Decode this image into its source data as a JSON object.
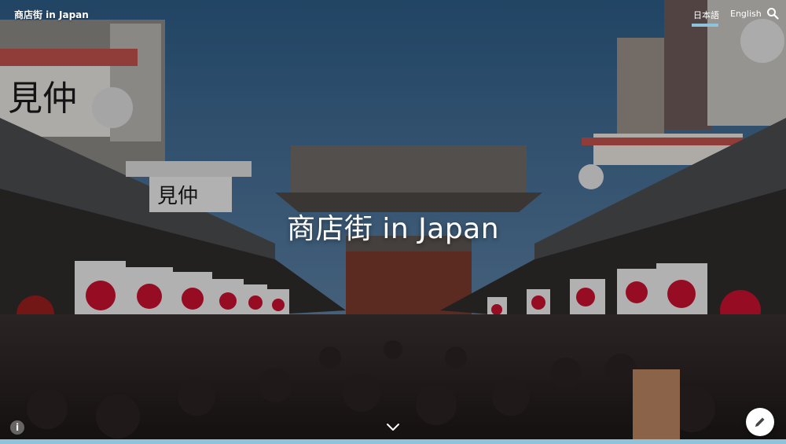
{
  "site": {
    "title": "商店街 in Japan"
  },
  "nav": {
    "languages": [
      {
        "label": "日本語",
        "active": true
      },
      {
        "label": "English",
        "active": false
      }
    ],
    "search_icon": "search-icon"
  },
  "hero": {
    "title": "商店街 in Japan",
    "background": "photo of crowded shopping street with red-and-white lanterns and Japanese flags leading to a temple gate"
  },
  "controls": {
    "scroll_icon": "chevron-down-icon",
    "info_icon": "info-icon",
    "info_glyph": "i",
    "edit_icon": "pencil-icon"
  },
  "colors": {
    "accent": "#8fc3dc",
    "sky": "#2f5f8a",
    "flag_red": "#c8102e"
  }
}
